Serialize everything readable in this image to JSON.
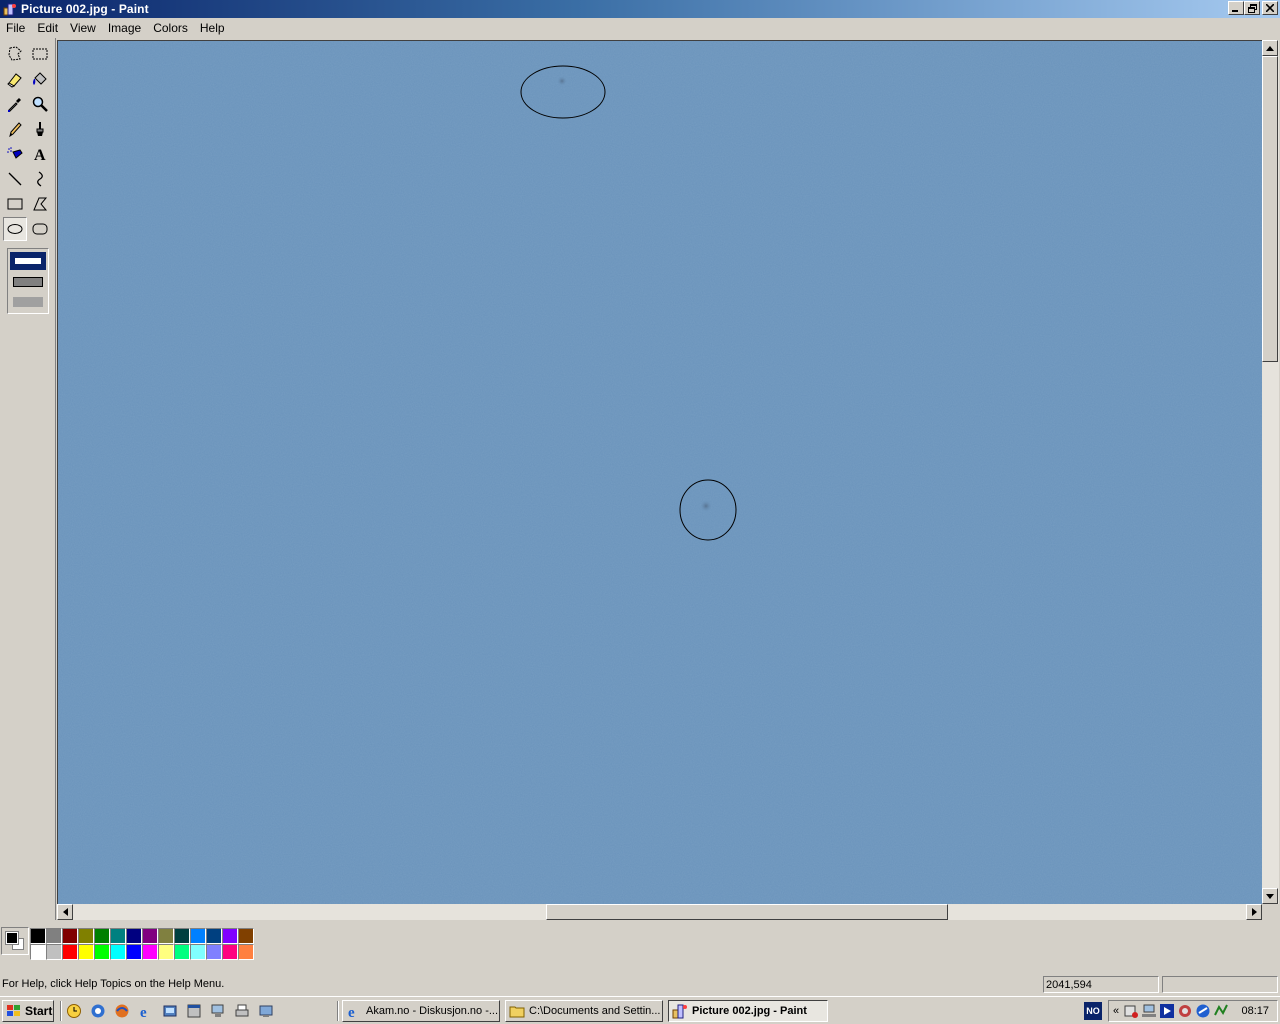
{
  "window": {
    "title": "Picture 002.jpg - Paint",
    "minimize_icon": "minimize-icon",
    "restore_icon": "restore-icon",
    "close_icon": "close-icon"
  },
  "menu": {
    "items": [
      "File",
      "Edit",
      "View",
      "Image",
      "Colors",
      "Help"
    ]
  },
  "toolbox": {
    "tools": [
      "free-form-select-icon",
      "select-icon",
      "eraser-icon",
      "fill-icon",
      "pick-color-icon",
      "magnifier-icon",
      "pencil-icon",
      "brush-icon",
      "airbrush-icon",
      "text-icon",
      "line-icon",
      "curve-icon",
      "rectangle-icon",
      "polygon-icon",
      "ellipse-icon",
      "rounded-rectangle-icon"
    ],
    "active_tool": "ellipse-icon"
  },
  "canvas": {
    "background_color": "#6a93bb"
  },
  "palette": {
    "foreground": "#000000",
    "background": "#ffffff",
    "colors": [
      "#000000",
      "#808080",
      "#800000",
      "#808000",
      "#008000",
      "#008080",
      "#000080",
      "#800080",
      "#808040",
      "#004040",
      "#0080ff",
      "#004080",
      "#8000ff",
      "#804000",
      "#ffffff",
      "#c0c0c0",
      "#ff0000",
      "#ffff00",
      "#00ff00",
      "#00ffff",
      "#0000ff",
      "#ff00ff",
      "#ffff80",
      "#00ff80",
      "#80ffff",
      "#8080ff",
      "#ff0080",
      "#ff8040"
    ]
  },
  "status": {
    "help_text": "For Help, click Help Topics on the Help Menu.",
    "coordinates": "2041,594",
    "size": ""
  },
  "taskbar": {
    "start_label": "Start",
    "tasks": [
      {
        "label": "Akam.no - Diskusjon.no -...",
        "icon": "internet-explorer-icon"
      },
      {
        "label": "C:\\Documents and Settin...",
        "icon": "folder-icon"
      },
      {
        "label": "Picture 002.jpg - Paint",
        "icon": "paint-icon"
      }
    ],
    "language": "NO",
    "clock": "08:17"
  }
}
